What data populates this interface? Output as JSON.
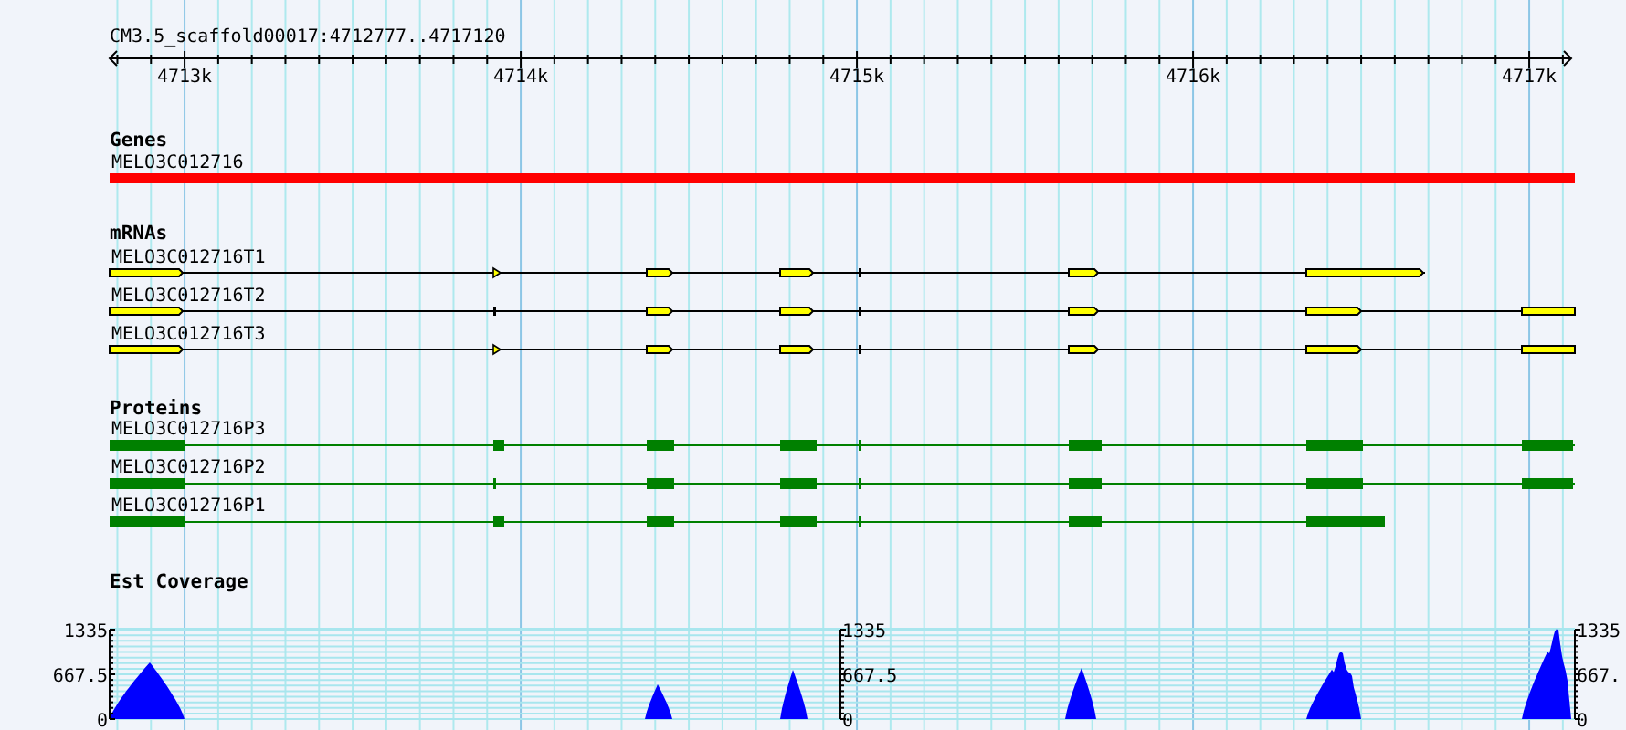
{
  "ruler": {
    "title": "CM3.5_scaffold00017:4712777..4717120",
    "tick_labels": [
      "4713k",
      "4714k",
      "4715k",
      "4716k",
      "4717k"
    ]
  },
  "tracks": [
    {
      "kind": "gene",
      "title": "Genes",
      "features": [
        {
          "label": "MELO3C012716"
        }
      ]
    },
    {
      "kind": "mrna",
      "title": "mRNAs",
      "features": [
        {
          "label": "MELO3C012716T1"
        },
        {
          "label": "MELO3C012716T2"
        },
        {
          "label": "MELO3C012716T3"
        }
      ]
    },
    {
      "kind": "protein",
      "title": "Proteins",
      "features": [
        {
          "label": "MELO3C012716P3"
        },
        {
          "label": "MELO3C012716P2"
        },
        {
          "label": "MELO3C012716P1"
        }
      ]
    },
    {
      "kind": "coverage",
      "title": "Est Coverage",
      "axes": [
        {
          "labels": [
            "1335",
            "667.5",
            "0"
          ]
        },
        {
          "labels": [
            "1335",
            "667.5",
            "0"
          ]
        },
        {
          "labels": [
            "1335",
            "667.",
            "0"
          ]
        }
      ]
    }
  ]
}
